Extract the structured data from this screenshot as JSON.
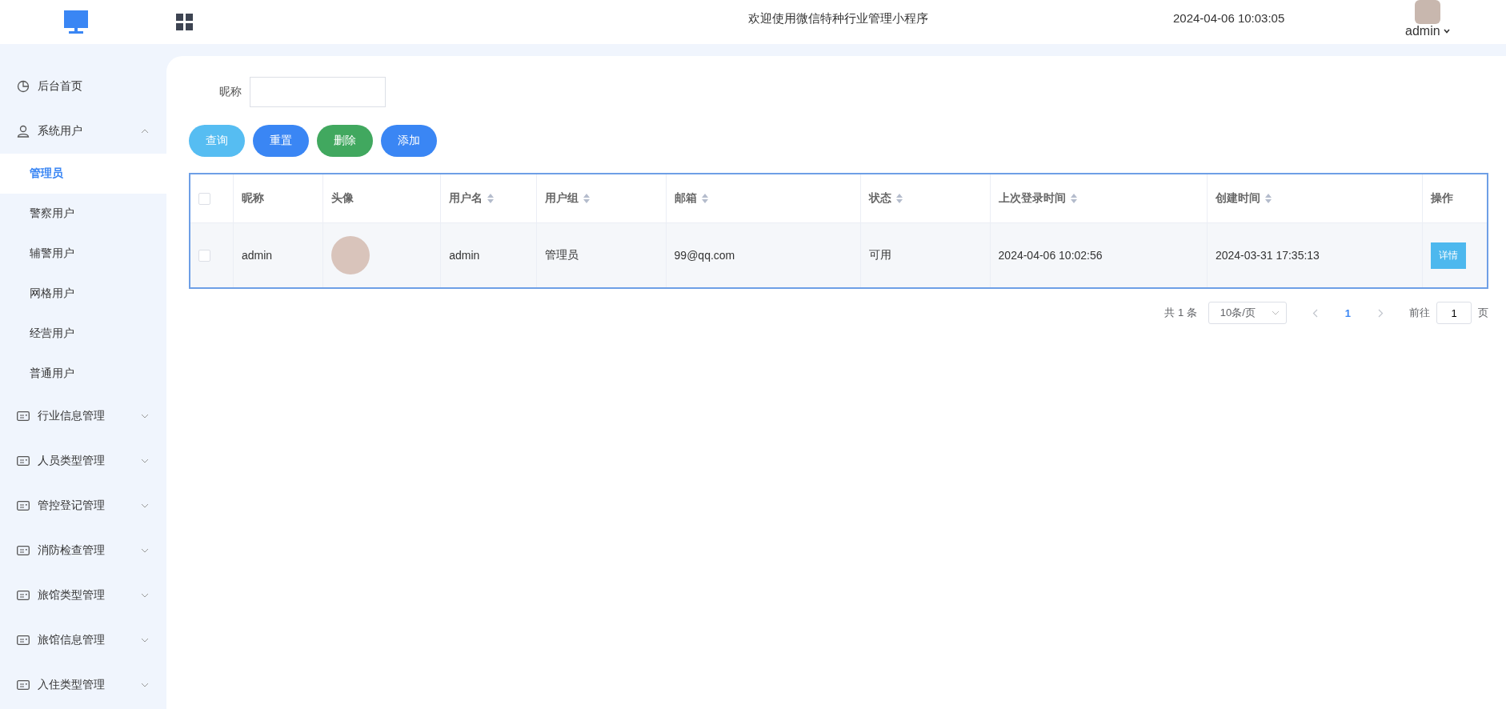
{
  "header": {
    "title": "欢迎使用微信特种行业管理小程序",
    "datetime": "2024-04-06 10:03:05",
    "user": "admin"
  },
  "sidebar": {
    "items": [
      {
        "kind": "item",
        "label": "后台首页"
      },
      {
        "kind": "group",
        "label": "系统用户",
        "expanded": true,
        "children": [
          {
            "label": "管理员",
            "selected": true
          },
          {
            "label": "警察用户",
            "selected": false
          },
          {
            "label": "辅警用户",
            "selected": false
          },
          {
            "label": "网格用户",
            "selected": false
          },
          {
            "label": "经营用户",
            "selected": false
          },
          {
            "label": "普通用户",
            "selected": false
          }
        ]
      },
      {
        "kind": "group",
        "label": "行业信息管理",
        "expanded": false
      },
      {
        "kind": "group",
        "label": "人员类型管理",
        "expanded": false
      },
      {
        "kind": "group",
        "label": "管控登记管理",
        "expanded": false
      },
      {
        "kind": "group",
        "label": "消防检查管理",
        "expanded": false
      },
      {
        "kind": "group",
        "label": "旅馆类型管理",
        "expanded": false
      },
      {
        "kind": "group",
        "label": "旅馆信息管理",
        "expanded": false
      },
      {
        "kind": "group",
        "label": "入住类型管理",
        "expanded": false
      }
    ]
  },
  "search": {
    "label": "昵称"
  },
  "buttons": [
    {
      "label": "查询",
      "color": "#56bdf2"
    },
    {
      "label": "重置",
      "color": "#3a86f4"
    },
    {
      "label": "删除",
      "color": "#41a85f"
    },
    {
      "label": "添加",
      "color": "#3a86f4"
    }
  ],
  "table": {
    "all_checked": false,
    "columns": [
      {
        "label": "昵称",
        "sortable": false
      },
      {
        "label": "头像",
        "sortable": false
      },
      {
        "label": "用户名",
        "sortable": true
      },
      {
        "label": "用户组",
        "sortable": true
      },
      {
        "label": "邮箱",
        "sortable": true
      },
      {
        "label": "状态",
        "sortable": true
      },
      {
        "label": "上次登录时间",
        "sortable": true
      },
      {
        "label": "创建时间",
        "sortable": true
      },
      {
        "label": "操作",
        "sortable": false
      }
    ],
    "rows": [
      {
        "checked": false,
        "cells": [
          "admin",
          null,
          "admin",
          "管理员",
          "99@qq.com",
          "可用",
          "2024-04-06 10:02:56",
          "2024-03-31 17:35:13"
        ],
        "action": "详情"
      }
    ]
  },
  "pagination": {
    "total": "共 1 条",
    "page_size": "10条/页",
    "pages": [
      {
        "label": "1",
        "selected": true
      }
    ],
    "goto_label": "前往",
    "goto_value": "1",
    "goto_suffix": "页"
  }
}
